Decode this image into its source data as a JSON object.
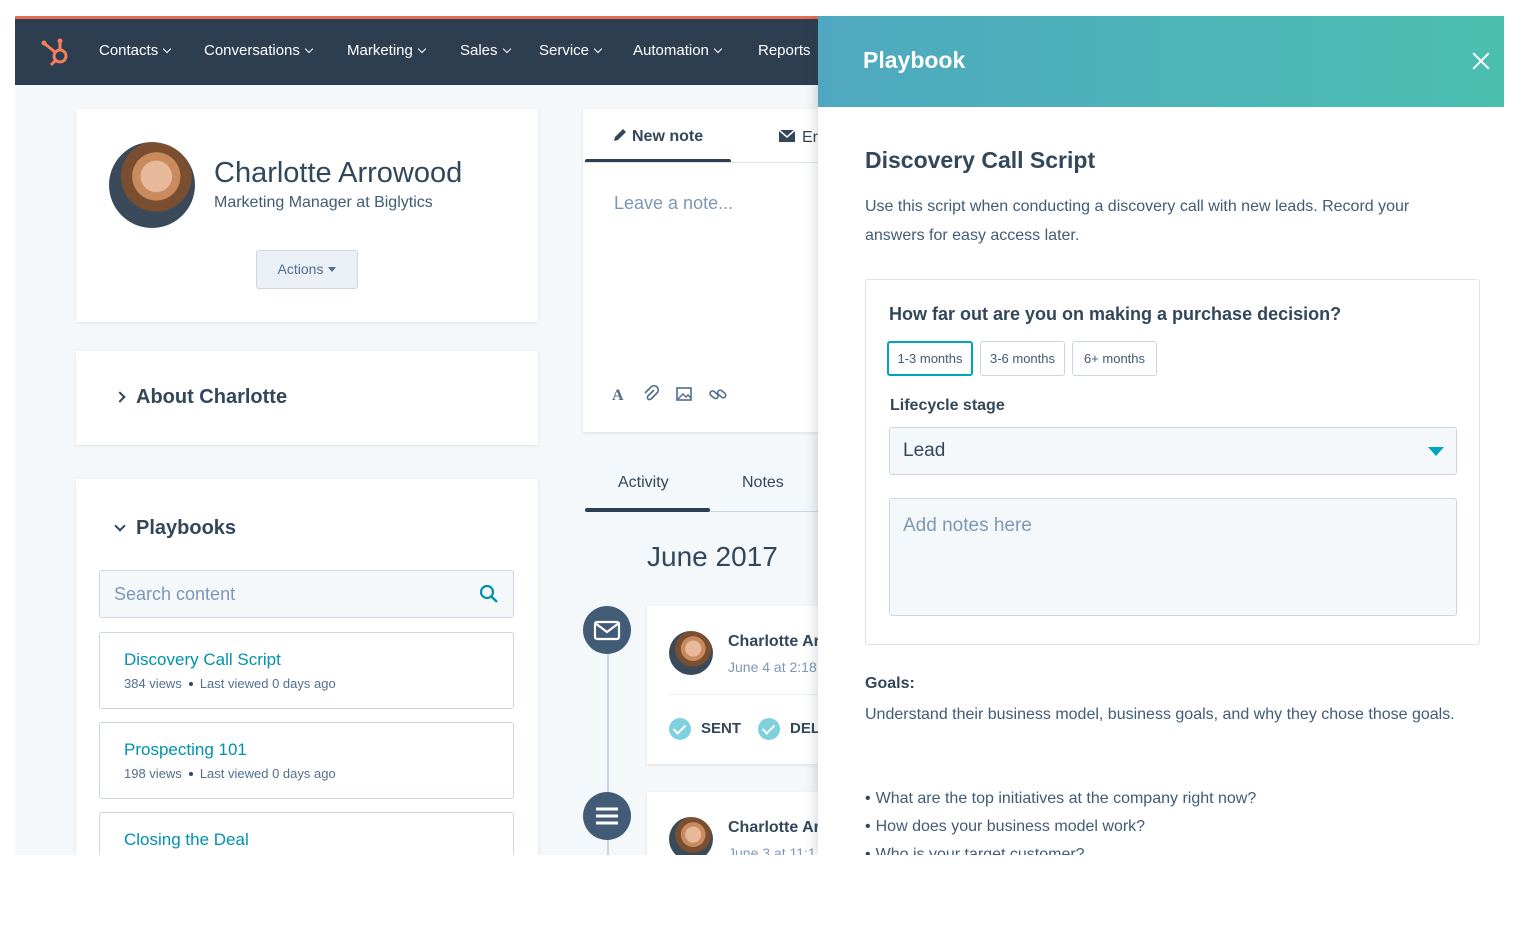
{
  "nav": {
    "items": [
      {
        "label": "Contacts"
      },
      {
        "label": "Conversations"
      },
      {
        "label": "Marketing"
      },
      {
        "label": "Sales"
      },
      {
        "label": "Service"
      },
      {
        "label": "Automation"
      },
      {
        "label": "Reports"
      }
    ]
  },
  "profile": {
    "name": "Charlotte Arrowood",
    "title": "Marketing Manager at Biglytics",
    "actions_label": "Actions"
  },
  "about": {
    "label": "About Charlotte"
  },
  "playbooks": {
    "heading": "Playbooks",
    "search_placeholder": "Search content",
    "items": [
      {
        "title": "Discovery Call Script",
        "views": "384 views",
        "last_viewed": "Last viewed 0 days ago"
      },
      {
        "title": "Prospecting 101",
        "views": "198 views",
        "last_viewed": "Last viewed 0 days ago"
      },
      {
        "title": "Closing the Deal"
      }
    ]
  },
  "composer": {
    "tab_new_note": "New note",
    "tab_email_partial": "Er",
    "placeholder": "Leave a note..."
  },
  "activity": {
    "tab_activity": "Activity",
    "tab_notes": "Notes",
    "month": "June 2017",
    "entries": [
      {
        "name": "Charlotte Ar",
        "time": "June 4 at 2:18",
        "status_sent": "SENT",
        "status_del": "DEL"
      },
      {
        "name": "Charlotte Ar",
        "time": "June 3 at 11:1"
      }
    ]
  },
  "panel": {
    "title": "Playbook",
    "script_title": "Discovery Call Script",
    "description": "Use this script when conducting a discovery call with new leads. Record your answers for easy access later.",
    "question": "How far out are you on making a purchase decision?",
    "options": [
      "1-3 months",
      "3-6 months",
      "6+ months"
    ],
    "selected_option": "1-3 months",
    "lifecycle_label": "Lifecycle stage",
    "lifecycle_value": "Lead",
    "notes_placeholder": "Add notes here",
    "goals_label": "Goals:",
    "goals_text": "Understand their business model, business goals, and why they chose those goals.",
    "bullets": [
      "What are the top initiatives at the company right now?",
      "How does your business model work?",
      "Who is your target customer?"
    ]
  },
  "colors": {
    "nav_bg": "#2d3e50",
    "accent_orange": "#e66e50",
    "link_teal": "#0091ae",
    "panel_gradient_start": "#4fa8c0",
    "panel_gradient_end": "#4bbfb0"
  },
  "icons": [
    "hubspot-logo-icon",
    "chevron-down-icon",
    "pencil-icon",
    "email-icon",
    "text-format-icon",
    "attachment-icon",
    "image-icon",
    "link-icon",
    "search-icon",
    "close-icon",
    "envelope-icon",
    "note-icon",
    "check-icon"
  ]
}
